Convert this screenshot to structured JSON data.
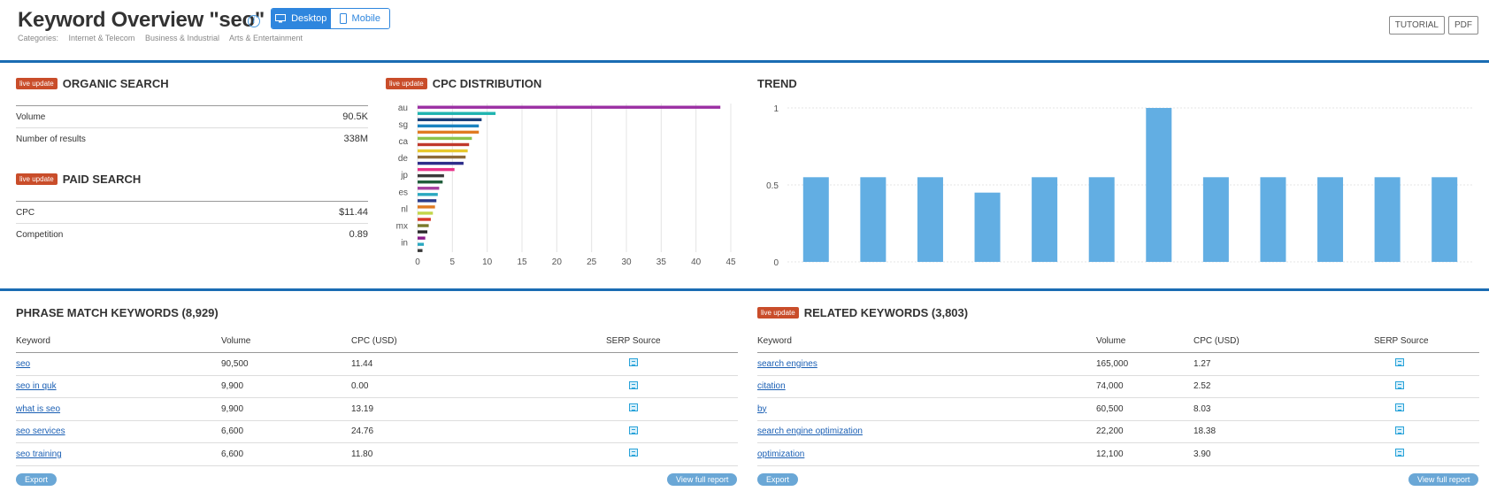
{
  "header": {
    "title": "Keyword Overview \"seo\"",
    "info_icon": "i",
    "device_toggle": {
      "desktop_label": "Desktop",
      "mobile_label": "Mobile",
      "active": "Desktop"
    },
    "categories_label": "Categories:",
    "categories": [
      "Internet & Telecom",
      "Business & Industrial",
      "Arts & Entertainment"
    ],
    "tutorial_label": "TUTORIAL",
    "pdf_label": "PDF"
  },
  "badges": {
    "live_update": "live update"
  },
  "organic": {
    "title": "ORGANIC SEARCH",
    "rows": [
      {
        "label": "Volume",
        "value": "90.5K"
      },
      {
        "label": "Number of results",
        "value": "338M"
      }
    ]
  },
  "paid": {
    "title": "PAID SEARCH",
    "rows": [
      {
        "label": "CPC",
        "value": "$11.44"
      },
      {
        "label": "Competition",
        "value": "0.89"
      }
    ]
  },
  "cpc_title": "CPC DISTRIBUTION",
  "trend_title": "TREND",
  "chart_data": [
    {
      "type": "bar",
      "title": "CPC DISTRIBUTION",
      "orientation": "horizontal",
      "categories": [
        "au",
        "",
        "sg",
        "",
        "ca",
        "",
        "de",
        "",
        "jp",
        "",
        "es",
        "",
        "nl",
        "",
        "mx",
        "",
        "in",
        ""
      ],
      "values": [
        43.5,
        11.2,
        9.2,
        8.8,
        8.8,
        7.8,
        7.4,
        7.2,
        6.9,
        6.6,
        5.3,
        3.8,
        3.6,
        3.1,
        2.9,
        2.7,
        2.5,
        2.2,
        1.9,
        1.6,
        1.4,
        1.1,
        0.9,
        0.7
      ],
      "colors": [
        "#9b2fa3",
        "#1fb4b0",
        "#1a3f7a",
        "#1a82c0",
        "#e07b22",
        "#8bc34a",
        "#c0392b",
        "#e8c82c",
        "#8e6a3a",
        "#2d2d8a",
        "#e8328a",
        "#3a3a3a",
        "#1f5d3a",
        "#a43fa0",
        "#2aa8c0",
        "#2a3a8a",
        "#e07b22",
        "#c3d64a",
        "#d83a2a",
        "#7a7a2a",
        "#2a2a2a",
        "#8a1a8a",
        "#2aa8c0",
        "#3a3a3a"
      ],
      "xticks": [
        0,
        5,
        10,
        15,
        20,
        25,
        30,
        35,
        40,
        45
      ],
      "xlim": [
        0,
        45
      ],
      "grid": true
    },
    {
      "type": "bar",
      "title": "TREND",
      "values": [
        0.55,
        0.55,
        0.55,
        0.45,
        0.55,
        0.55,
        1.0,
        0.55,
        0.55,
        0.55,
        0.55,
        0.55
      ],
      "yticks": [
        0,
        0.5,
        1
      ],
      "ylim": [
        0,
        1
      ],
      "color": "#62aee3",
      "grid": true
    }
  ],
  "phrase": {
    "title": "PHRASE MATCH KEYWORDS (8,929)",
    "columns": [
      "Keyword",
      "Volume",
      "CPC (USD)",
      "SERP Source"
    ],
    "rows": [
      {
        "keyword": "seo",
        "volume": "90,500",
        "cpc": "11.44"
      },
      {
        "keyword": "seo in quk",
        "volume": "9,900",
        "cpc": "0.00"
      },
      {
        "keyword": "what is seo",
        "volume": "9,900",
        "cpc": "13.19"
      },
      {
        "keyword": "seo services",
        "volume": "6,600",
        "cpc": "24.76"
      },
      {
        "keyword": "seo training",
        "volume": "6,600",
        "cpc": "11.80"
      }
    ],
    "export_label": "Export",
    "full_report_label": "View full report"
  },
  "related": {
    "title": "RELATED KEYWORDS (3,803)",
    "columns": [
      "Keyword",
      "Volume",
      "CPC (USD)",
      "SERP Source"
    ],
    "rows": [
      {
        "keyword": "search engines",
        "volume": "165,000",
        "cpc": "1.27"
      },
      {
        "keyword": "citation",
        "volume": "74,000",
        "cpc": "2.52"
      },
      {
        "keyword": "by",
        "volume": "60,500",
        "cpc": "8.03"
      },
      {
        "keyword": "search engine optimization",
        "volume": "22,200",
        "cpc": "18.38"
      },
      {
        "keyword": "optimization",
        "volume": "12,100",
        "cpc": "3.90"
      }
    ],
    "export_label": "Export",
    "full_report_label": "View full report"
  }
}
